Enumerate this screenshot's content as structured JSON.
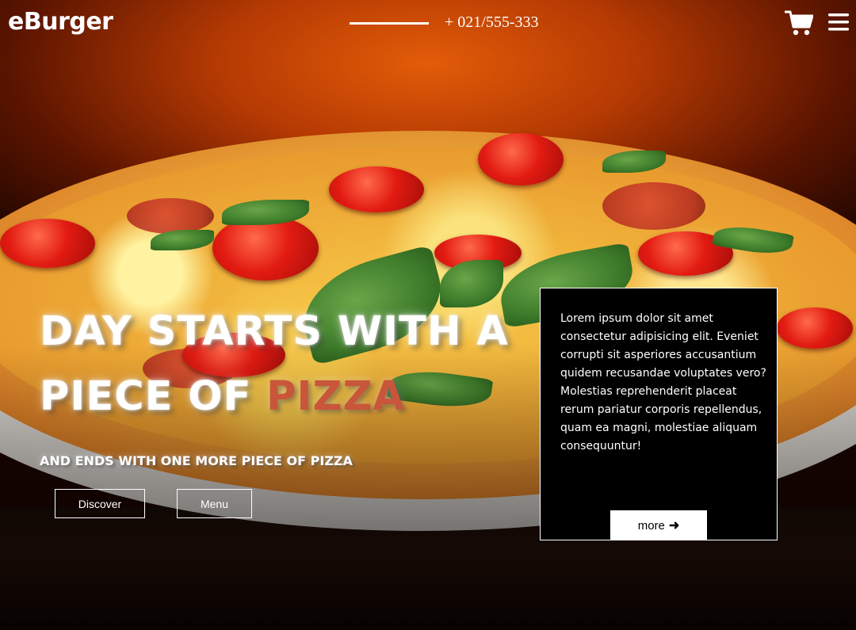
{
  "header": {
    "logo": "eBurger",
    "phone": "+ 021/555-333",
    "icons": {
      "cart": "cart-icon",
      "menu": "hamburger-menu-icon"
    }
  },
  "hero": {
    "headline_line1": "DAY STARTS WITH A",
    "headline_line2_prefix": "PIECE OF ",
    "headline_line2_accent": "PIZZA",
    "subline": "AND ENDS WITH ONE MORE PIECE OF PIZZA",
    "buttons": {
      "discover": "Discover",
      "menu": "Menu"
    },
    "accent_color": "#c9553a"
  },
  "card": {
    "text": "Lorem ipsum dolor sit amet consectetur adipisicing elit. Eveniet corrupti sit asperiores accusantium quidem recusandae voluptates vero? Molestias reprehenderit placeat rerum pariatur corporis repellendus, quam ea magni, molestiae aliquam consequuntur!",
    "more_label": "more",
    "more_icon": "arrow-right-icon"
  }
}
